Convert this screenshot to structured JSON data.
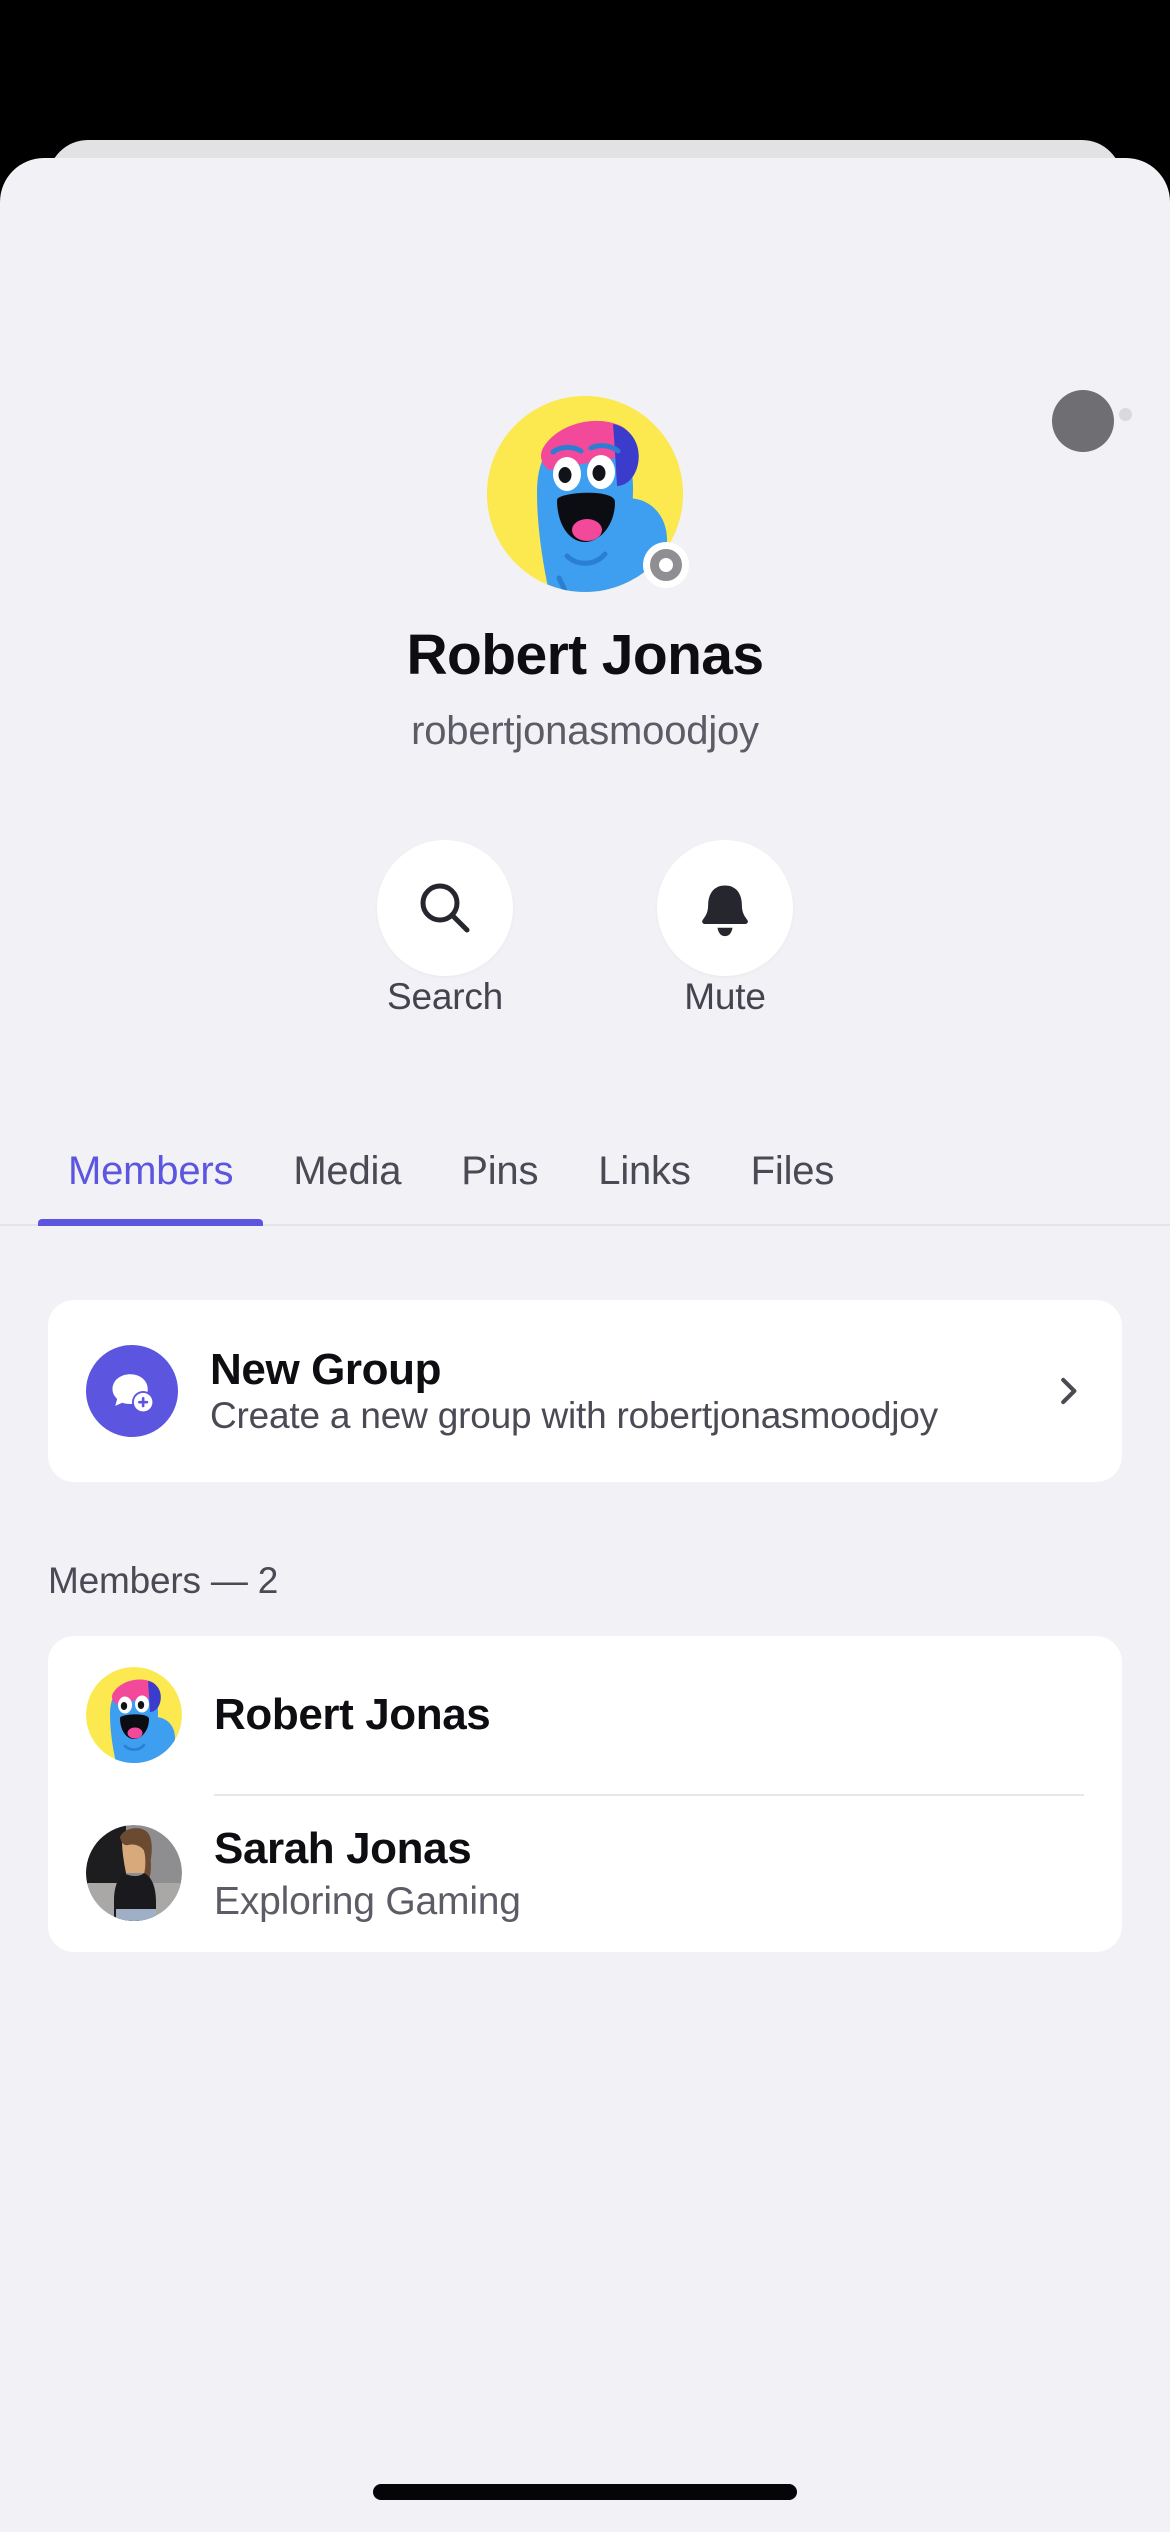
{
  "profile": {
    "display_name": "Robert Jonas",
    "handle": "robertjonasmoodjoy",
    "avatar_icon": "moodjoy-blue-character-avatar",
    "status_badge_icon": "offline-status-icon",
    "top_right_avatar_icon": "placeholder-avatar-icon"
  },
  "actions": [
    {
      "label": "Search",
      "icon": "search-icon"
    },
    {
      "label": "Mute",
      "icon": "bell-icon"
    }
  ],
  "tabs": [
    {
      "label": "Members",
      "active": true
    },
    {
      "label": "Media",
      "active": false
    },
    {
      "label": "Pins",
      "active": false
    },
    {
      "label": "Links",
      "active": false
    },
    {
      "label": "Files",
      "active": false
    }
  ],
  "new_group": {
    "title": "New Group",
    "subtitle": "Create a new group with robertjonasmoodjoy",
    "icon": "add-person-chat-icon",
    "chevron_icon": "chevron-right-icon"
  },
  "members_section": {
    "label": "Members — 2",
    "items": [
      {
        "name": "Robert Jonas",
        "subtitle": "",
        "avatar_icon": "moodjoy-blue-character-avatar"
      },
      {
        "name": "Sarah Jonas",
        "subtitle": "Exploring Gaming",
        "avatar_icon": "photo-avatar"
      }
    ]
  },
  "colors": {
    "accent": "#5b55e0",
    "sheet_bg": "#f2f1f5",
    "card_bg": "#ffffff",
    "avatar_yellow": "#fbe94f",
    "avatar_blue": "#3e9ef0",
    "avatar_pink": "#f2499b"
  },
  "system": {
    "home_indicator": "home-indicator"
  }
}
